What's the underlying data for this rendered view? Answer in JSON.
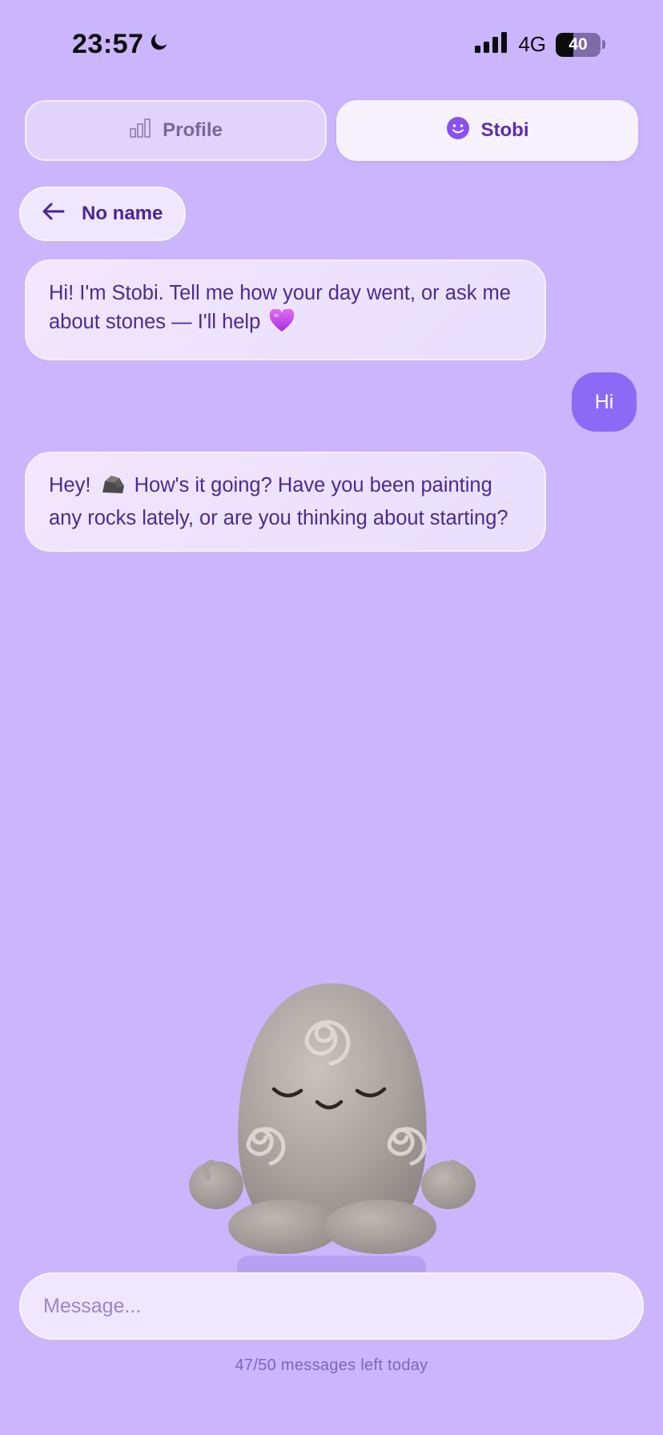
{
  "status_bar": {
    "time": "23:57",
    "network": "4G",
    "battery_level": "40",
    "battery_fraction": 0.4,
    "icons": [
      "moon-icon",
      "signal-bars-icon",
      "battery-icon"
    ]
  },
  "tabs": [
    {
      "label": "Profile",
      "icon": "chart-bars-icon",
      "active": false
    },
    {
      "label": "Stobi",
      "icon": "smile-face-icon",
      "active": true
    }
  ],
  "chat": {
    "back_label": "No name",
    "back_icon": "arrow-left-icon",
    "messages": [
      {
        "role": "assistant",
        "text": "Hi! I'm Stobi. Tell me how your day went, or ask me about stones — I'll help",
        "emoji": "purple-heart-icon"
      },
      {
        "role": "user",
        "text": "Hi"
      },
      {
        "role": "assistant",
        "pre": "Hey!",
        "emoji": "rock-icon",
        "text": "How's it going? Have you been painting any rocks lately, or are you thinking about starting?"
      }
    ]
  },
  "composer": {
    "placeholder": "Message...",
    "counter": "47/50 messages left today"
  },
  "colors": {
    "background": "#cbb5fd",
    "accent": "#8c6af6",
    "text_primary": "#4c2b91"
  }
}
